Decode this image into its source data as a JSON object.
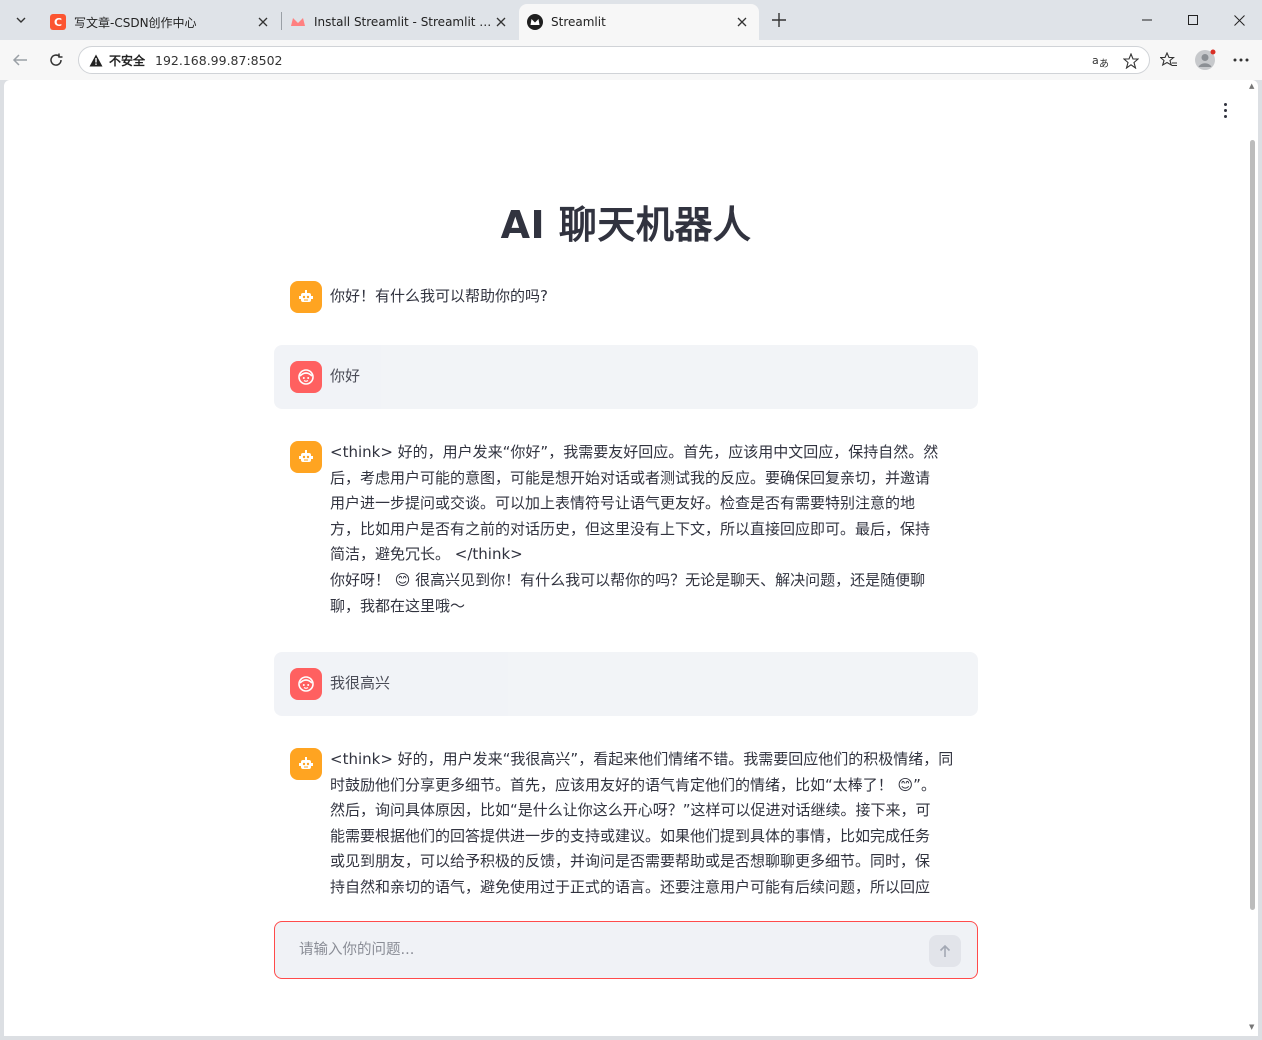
{
  "browser": {
    "tabs": [
      {
        "title": "写文章-CSDN创作中心",
        "favicon": "csdn-c-icon",
        "active": false
      },
      {
        "title": "Install Streamlit - Streamlit Docs",
        "favicon": "streamlit-crown-icon",
        "active": false
      },
      {
        "title": "Streamlit",
        "favicon": "streamlit-crown-icon",
        "active": true
      }
    ],
    "security_label": "不安全",
    "url": "192.168.99.87:8502",
    "colors": {
      "tabstrip": "#dfe3e8",
      "toolbar": "#f7f7f7"
    }
  },
  "app": {
    "title": "AI 聊天机器人",
    "messages": [
      {
        "role": "assistant",
        "lines": [
          "你好！有什么我可以帮助你的吗?"
        ]
      },
      {
        "role": "user",
        "lines": [
          "你好"
        ]
      },
      {
        "role": "assistant",
        "lines": [
          "<think> 好的，用户发来“你好”，我需要友好回应。首先，应该用中文回应，保持自然。然",
          "后，考虑用户可能的意图，可能是想开始对话或者测试我的反应。要确保回复亲切，并邀请",
          "用户进一步提问或交谈。可以加上表情符号让语气更友好。检查是否有需要特别注意的地",
          "方，比如用户是否有之前的对话历史，但这里没有上下文，所以直接回应即可。最后，保持",
          "简洁，避免冗长。 </think>",
          "你好呀！ 😊 很高兴见到你！有什么我可以帮你的吗？无论是聊天、解决问题，还是随便聊",
          "聊，我都在这里哦～"
        ]
      },
      {
        "role": "user",
        "lines": [
          "我很高兴"
        ]
      },
      {
        "role": "assistant",
        "lines": [
          "<think> 好的，用户发来“我很高兴”，看起来他们情绪不错。我需要回应他们的积极情绪，同",
          "时鼓励他们分享更多细节。首先，应该用友好的语气肯定他们的情绪，比如“太棒了！ 😊”。",
          "然后，询问具体原因，比如“是什么让你这么开心呀？”这样可以促进对话继续。接下来，可",
          "能需要根据他们的回答提供进一步的支持或建议。如果他们提到具体的事情，比如完成任务",
          "或见到朋友，可以给予积极的反馈，并询问是否需要帮助或是否想聊聊更多细节。同时，保",
          "持自然和亲切的语气，避免使用过于正式的语言。还要注意用户可能有后续问题，所以回应"
        ]
      }
    ],
    "input": {
      "placeholder": "请输入你的问题...",
      "value": ""
    },
    "colors": {
      "bot_avatar": "#ffa421",
      "user_avatar": "#ff4b4b",
      "user_bubble": "#f0f2f6",
      "input_border": "#ff4b4b",
      "text": "#31333f"
    }
  }
}
